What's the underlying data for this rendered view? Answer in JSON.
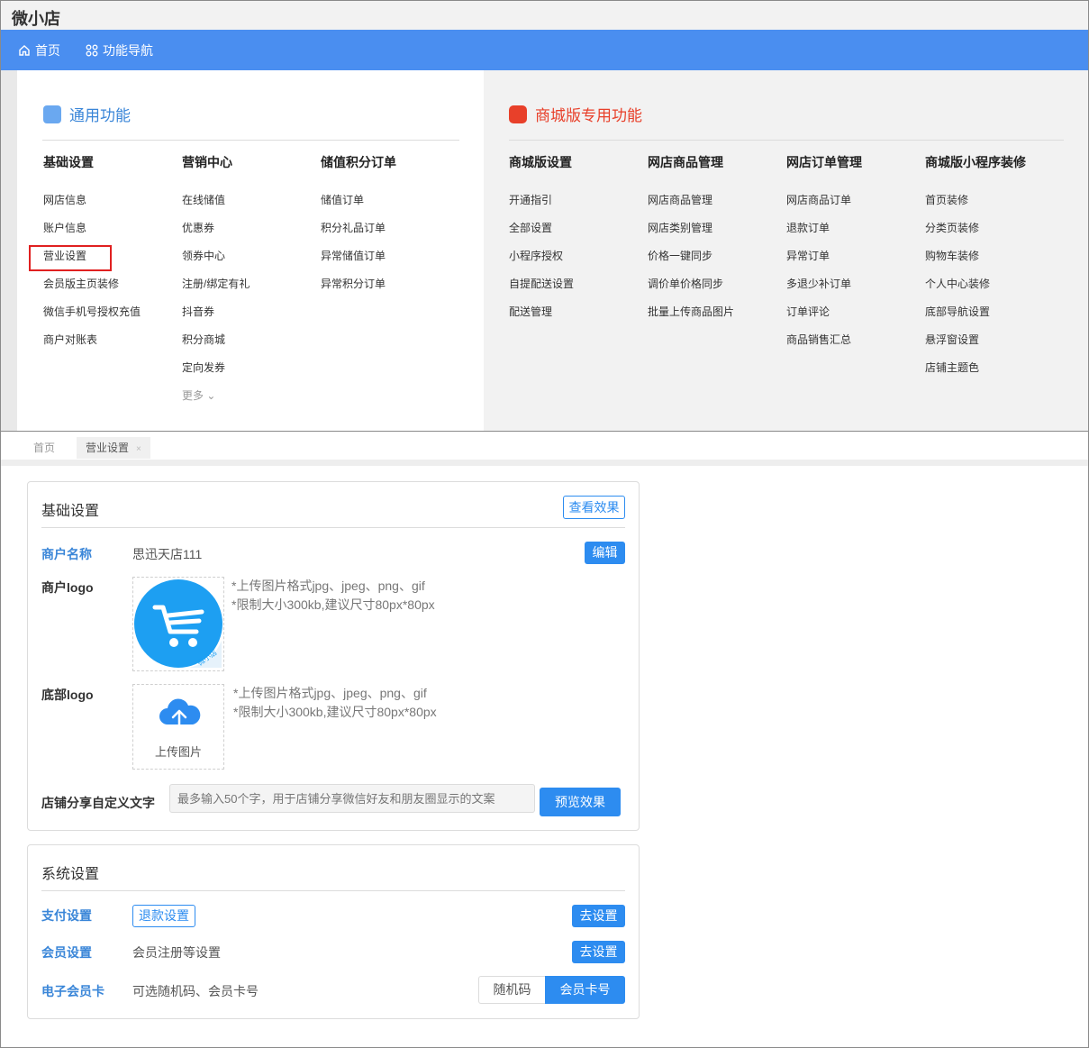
{
  "app": {
    "title": "微小店"
  },
  "nav": {
    "home": "首页",
    "features": "功能导航"
  },
  "general": {
    "title": "通用功能",
    "columns": [
      {
        "head": "基础设置",
        "items": [
          "网店信息",
          "账户信息",
          "营业设置",
          "会员版主页装修",
          "微信手机号授权充值",
          "商户对账表"
        ]
      },
      {
        "head": "营销中心",
        "items": [
          "在线储值",
          "优惠券",
          "领券中心",
          "注册/绑定有礼",
          "抖音券",
          "积分商城",
          "定向发券"
        ],
        "more": "更多"
      },
      {
        "head": "储值积分订单",
        "items": [
          "储值订单",
          "积分礼品订单",
          "异常储值订单",
          "异常积分订单"
        ]
      }
    ]
  },
  "mall": {
    "title": "商城版专用功能",
    "columns": [
      {
        "head": "商城版设置",
        "items": [
          "开通指引",
          "全部设置",
          "小程序授权",
          "自提配送设置",
          "配送管理"
        ]
      },
      {
        "head": "网店商品管理",
        "items": [
          "网店商品管理",
          "网店类别管理",
          "价格一键同步",
          "调价单价格同步",
          "批量上传商品图片"
        ]
      },
      {
        "head": "网店订单管理",
        "items": [
          "网店商品订单",
          "退款订单",
          "异常订单",
          "多退少补订单",
          "订单评论",
          "商品销售汇总"
        ]
      },
      {
        "head": "商城版小程序装修",
        "items": [
          "首页装修",
          "分类页装修",
          "购物车装修",
          "个人中心装修",
          "底部导航设置",
          "悬浮窗设置",
          "店铺主题色"
        ]
      }
    ]
  },
  "tabs": {
    "home": "首页",
    "current": "营业设置",
    "close": "×"
  },
  "basic": {
    "title": "基础设置",
    "view_effect": "查看效果",
    "merchant_name_label": "商户名称",
    "merchant_name": "思迅天店111",
    "edit": "编辑",
    "logo_label": "商户logo",
    "logo_badge": "微小店",
    "hint1": "*上传图片格式jpg、jpeg、png、gif",
    "hint2": "*限制大小300kb,建议尺寸80px*80px",
    "bottom_logo_label": "底部logo",
    "upload_text": "上传图片",
    "share_label": "店铺分享自定义文字",
    "share_placeholder": "最多输入50个字，用于店铺分享微信好友和朋友圈显示的文案",
    "preview": "预览效果"
  },
  "system": {
    "title": "系统设置",
    "pay_label": "支付设置",
    "refund": "退款设置",
    "go_set": "去设置",
    "member_label": "会员设置",
    "member_desc": "会员注册等设置",
    "card_label": "电子会员卡",
    "card_desc": "可选随机码、会员卡号",
    "random_code": "随机码",
    "member_no": "会员卡号"
  },
  "colors": {
    "nav": "#4a8ef0",
    "accent": "#2d8cf0",
    "mall_title": "#e8402a",
    "general_title": "#3a86d8",
    "highlight": "#e02020"
  }
}
